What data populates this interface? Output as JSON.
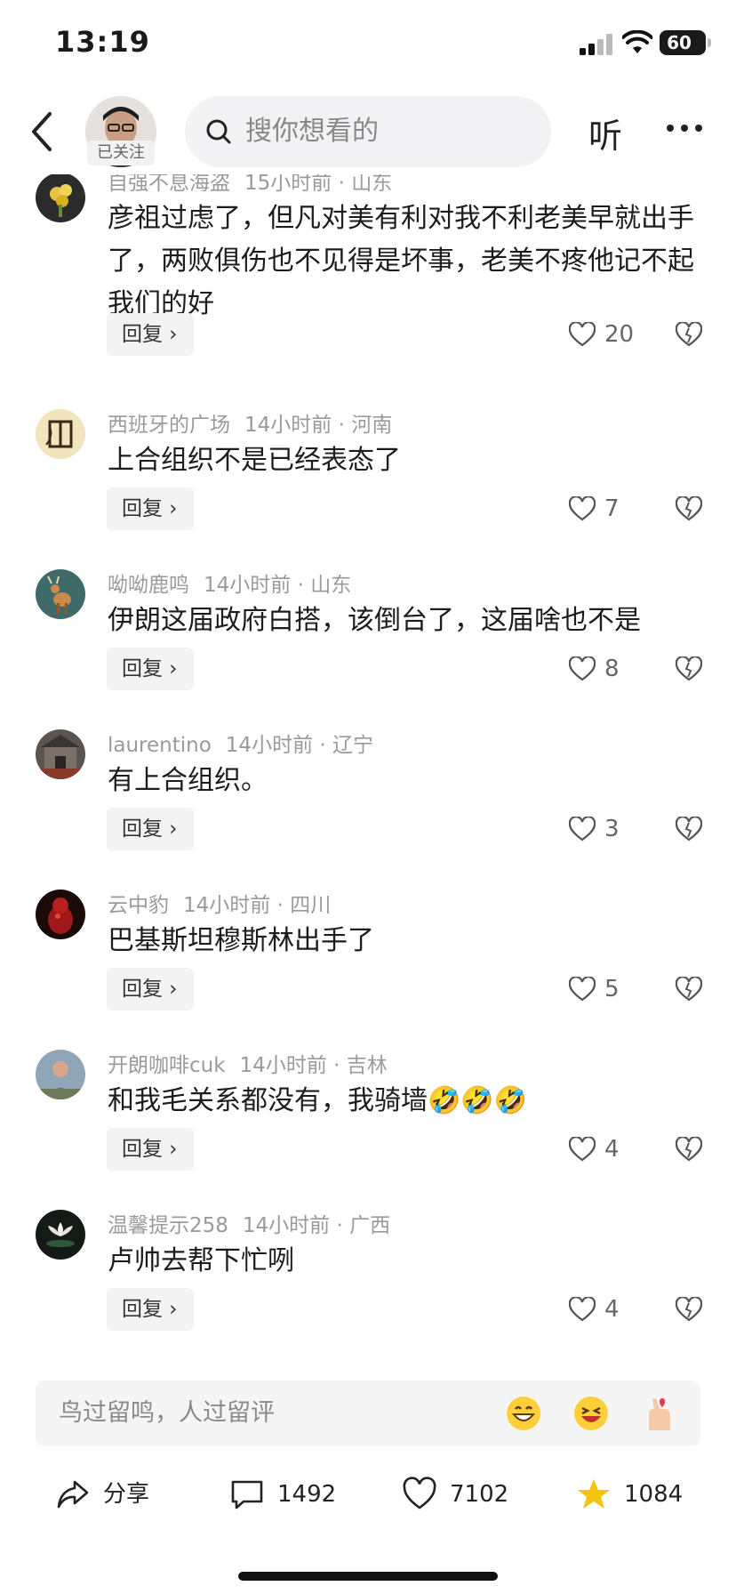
{
  "status_bar": {
    "time": "13:19",
    "battery": "60"
  },
  "header": {
    "follow_label": "已关注",
    "search_placeholder": "搜你想看的",
    "listen_label": "听"
  },
  "comments": [
    {
      "name": "自强不息海盗",
      "time": "15小时前",
      "location": "山东",
      "text": "彦祖过虑了，但凡对美有利对我不利老美早就出手了，两败俱伤也不见得是坏事，老美不疼他记不起我们的好",
      "likes": "20",
      "reply_label": "回复 ›"
    },
    {
      "name": "西班牙的广场",
      "time": "14小时前",
      "location": "河南",
      "text": "上合组织不是已经表态了",
      "likes": "7",
      "reply_label": "回复 ›"
    },
    {
      "name": "呦呦鹿鸣",
      "time": "14小时前",
      "location": "山东",
      "text": "伊朗这届政府白搭，该倒台了，这届啥也不是",
      "likes": "8",
      "reply_label": "回复 ›"
    },
    {
      "name": "laurentino",
      "time": "14小时前",
      "location": "辽宁",
      "text": "有上合组织。",
      "likes": "3",
      "reply_label": "回复 ›"
    },
    {
      "name": "云中豹",
      "time": "14小时前",
      "location": "四川",
      "text": "巴基斯坦穆斯林出手了",
      "likes": "5",
      "reply_label": "回复 ›"
    },
    {
      "name": "开朗咖啡cuk",
      "time": "14小时前",
      "location": "吉林",
      "text": "和我毛关系都没有，我骑墙🤣🤣🤣",
      "likes": "4",
      "reply_label": "回复 ›"
    },
    {
      "name": "温馨提示258",
      "time": "14小时前",
      "location": "广西",
      "text": "卢帅去帮下忙咧",
      "likes": "4",
      "reply_label": "回复 ›"
    }
  ],
  "input_bar": {
    "placeholder": "鸟过留鸣，人过留评"
  },
  "bottom_bar": {
    "share_label": "分享",
    "comment_count": "1492",
    "like_count": "7102",
    "star_count": "1084"
  }
}
